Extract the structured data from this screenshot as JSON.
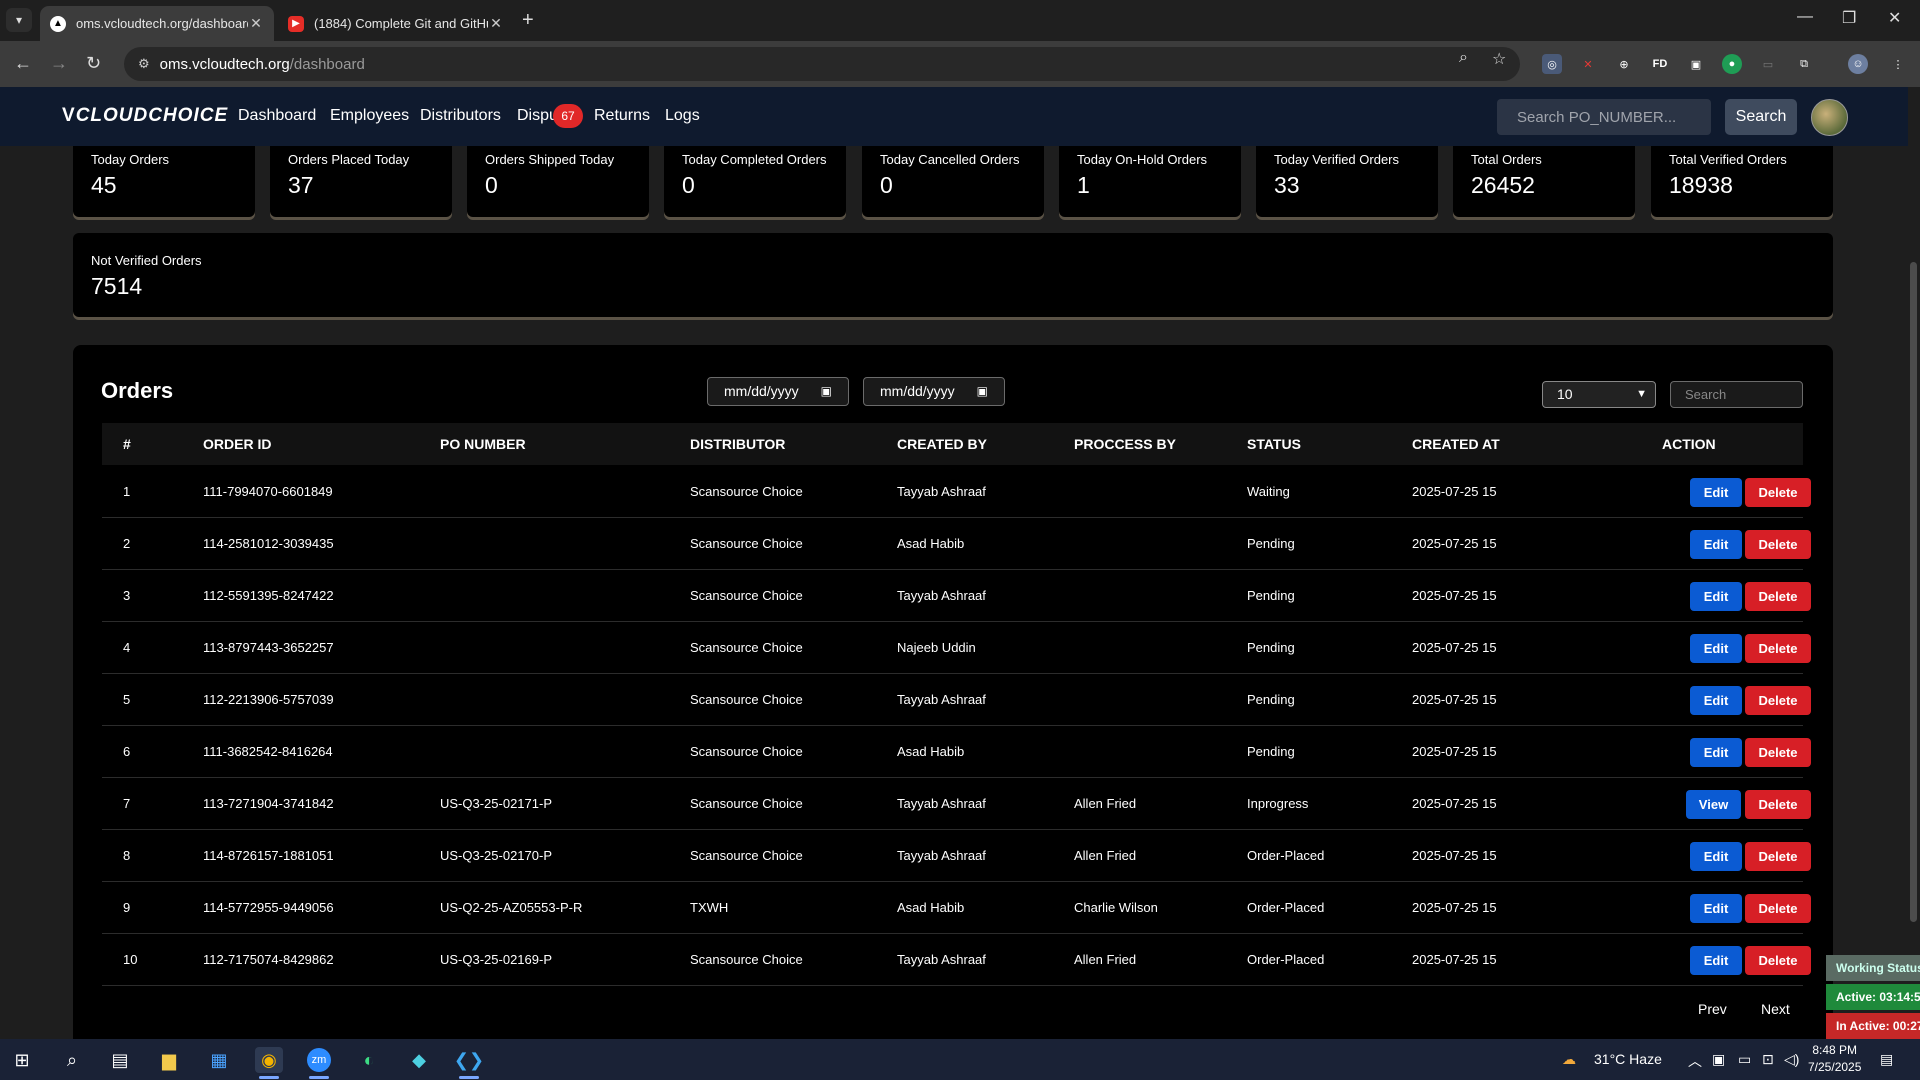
{
  "browser": {
    "tabs": [
      {
        "title": "oms.vcloudtech.org/dashboard",
        "active": true
      },
      {
        "title": "(1884) Complete Git and GitHu",
        "active": false
      }
    ],
    "url_host": "oms.vcloudtech.org",
    "url_path": "/dashboard"
  },
  "nav": {
    "logo": "CLOUDCHOICE",
    "links": [
      "Dashboard",
      "Employees",
      "Distributors",
      "Dispu",
      "Returns",
      "Logs"
    ],
    "dispute_badge": "67",
    "search_placeholder": "Search PO_NUMBER...",
    "search_button": "Search"
  },
  "stats": [
    {
      "label": "Today Orders",
      "value": "45"
    },
    {
      "label": "Orders Placed Today",
      "value": "37"
    },
    {
      "label": "Orders Shipped Today",
      "value": "0"
    },
    {
      "label": "Today Completed Orders",
      "value": "0"
    },
    {
      "label": "Today Cancelled Orders",
      "value": "0"
    },
    {
      "label": "Today On-Hold Orders",
      "value": "1"
    },
    {
      "label": "Today Verified Orders",
      "value": "33"
    },
    {
      "label": "Total Orders",
      "value": "26452"
    },
    {
      "label": "Total Verified Orders",
      "value": "18938"
    }
  ],
  "not_verified": {
    "label": "Not Verified Orders",
    "value": "7514"
  },
  "orders": {
    "title": "Orders",
    "date_from": "mm/dd/yyyy",
    "date_to": "mm/dd/yyyy",
    "page_size": "10",
    "search_placeholder": "Search",
    "columns": [
      "#",
      "ORDER ID",
      "PO NUMBER",
      "DISTRIBUTOR",
      "CREATED BY",
      "PROCCESS BY",
      "STATUS",
      "CREATED AT",
      "ACTION"
    ],
    "rows": [
      {
        "num": "1",
        "order_id": "111-7994070-6601849",
        "po": "",
        "distributor": "Scansource Choice",
        "created_by": "Tayyab Ashraaf",
        "process_by": "",
        "status": "Waiting",
        "created_at": "2025-07-25 15",
        "primary": "Edit",
        "secondary": "Delete"
      },
      {
        "num": "2",
        "order_id": "114-2581012-3039435",
        "po": "",
        "distributor": "Scansource Choice",
        "created_by": "Asad Habib",
        "process_by": "",
        "status": "Pending",
        "created_at": "2025-07-25 15",
        "primary": "Edit",
        "secondary": "Delete"
      },
      {
        "num": "3",
        "order_id": "112-5591395-8247422",
        "po": "",
        "distributor": "Scansource Choice",
        "created_by": "Tayyab Ashraaf",
        "process_by": "",
        "status": "Pending",
        "created_at": "2025-07-25 15",
        "primary": "Edit",
        "secondary": "Delete"
      },
      {
        "num": "4",
        "order_id": "113-8797443-3652257",
        "po": "",
        "distributor": "Scansource Choice",
        "created_by": "Najeeb Uddin",
        "process_by": "",
        "status": "Pending",
        "created_at": "2025-07-25 15",
        "primary": "Edit",
        "secondary": "Delete"
      },
      {
        "num": "5",
        "order_id": "112-2213906-5757039",
        "po": "",
        "distributor": "Scansource Choice",
        "created_by": "Tayyab Ashraaf",
        "process_by": "",
        "status": "Pending",
        "created_at": "2025-07-25 15",
        "primary": "Edit",
        "secondary": "Delete"
      },
      {
        "num": "6",
        "order_id": "111-3682542-8416264",
        "po": "",
        "distributor": "Scansource Choice",
        "created_by": "Asad Habib",
        "process_by": "",
        "status": "Pending",
        "created_at": "2025-07-25 15",
        "primary": "Edit",
        "secondary": "Delete"
      },
      {
        "num": "7",
        "order_id": "113-7271904-3741842",
        "po": "US-Q3-25-02171-P",
        "distributor": "Scansource Choice",
        "created_by": "Tayyab Ashraaf",
        "process_by": "Allen Fried",
        "status": "Inprogress",
        "created_at": "2025-07-25 15",
        "primary": "View",
        "secondary": "Delete"
      },
      {
        "num": "8",
        "order_id": "114-8726157-1881051",
        "po": "US-Q3-25-02170-P",
        "distributor": "Scansource Choice",
        "created_by": "Tayyab Ashraaf",
        "process_by": "Allen Fried",
        "status": "Order-Placed",
        "created_at": "2025-07-25 15",
        "primary": "Edit",
        "secondary": "Delete"
      },
      {
        "num": "9",
        "order_id": "114-5772955-9449056",
        "po": "US-Q2-25-AZ05553-P-R",
        "distributor": "TXWH",
        "created_by": "Asad Habib",
        "process_by": "Charlie Wilson",
        "status": "Order-Placed",
        "created_at": "2025-07-25 15",
        "primary": "Edit",
        "secondary": "Delete"
      },
      {
        "num": "10",
        "order_id": "112-7175074-8429862",
        "po": "US-Q3-25-02169-P",
        "distributor": "Scansource Choice",
        "created_by": "Tayyab Ashraaf",
        "process_by": "Allen Fried",
        "status": "Order-Placed",
        "created_at": "2025-07-25 15",
        "primary": "Edit",
        "secondary": "Delete"
      }
    ],
    "prev": "Prev",
    "next": "Next"
  },
  "work_status": {
    "title": "Working Status",
    "active": "Active: 03:14:5",
    "inactive": "In Active: 00:27"
  },
  "taskbar": {
    "weather": "31°C  Haze",
    "time": "8:48 PM",
    "date": "7/25/2025"
  },
  "colors": {
    "nav_bg": "#0f1a2e",
    "edit_button": "#0b5bd3",
    "delete_button": "#d71f26",
    "badge": "#e12828",
    "status_active": "#1f8a3b",
    "status_inactive": "#c62828"
  }
}
